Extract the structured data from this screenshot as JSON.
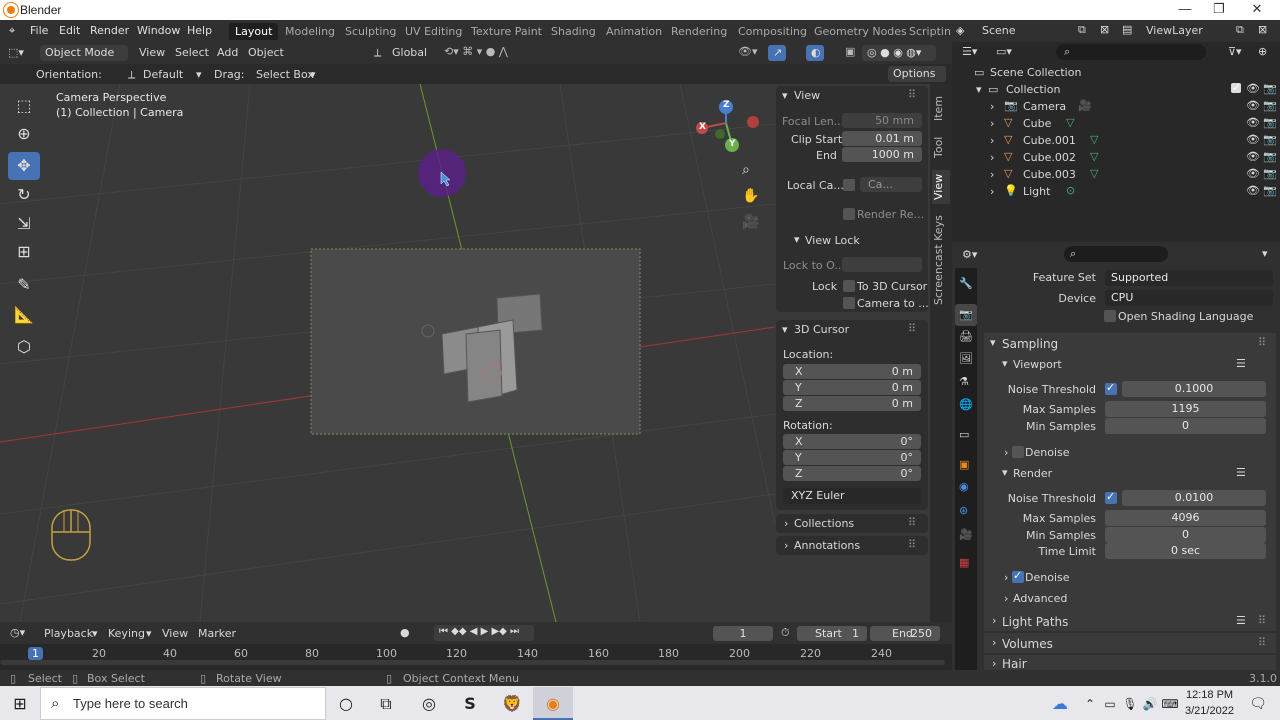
{
  "window": {
    "title": "Blender"
  },
  "menu": [
    "File",
    "Edit",
    "Render",
    "Window",
    "Help"
  ],
  "workspaces": [
    "Layout",
    "Modeling",
    "Sculpting",
    "UV Editing",
    "Texture Paint",
    "Shading",
    "Animation",
    "Rendering",
    "Compositing",
    "Geometry Nodes",
    "Scriptin"
  ],
  "scene": {
    "label": "Scene",
    "view_layer": "ViewLayer"
  },
  "viewport_header": {
    "mode": "Object Mode",
    "menus": [
      "View",
      "Select",
      "Add",
      "Object"
    ],
    "transform": "Global",
    "orientation_label": "Orientation:",
    "orientation_value": "Default",
    "drag_label": "Drag:",
    "drag_value": "Select Box",
    "options": "Options"
  },
  "viewport": {
    "title": "Camera Perspective",
    "subtitle": "(1) Collection | Camera",
    "gizmo": {
      "x": "X",
      "y": "Y",
      "z": "Z"
    }
  },
  "npanel": {
    "view": {
      "header": "View",
      "focal_label": "Focal Len...",
      "focal_value": "50 mm",
      "clip_start_label": "Clip Start",
      "clip_start_value": "0.01 m",
      "end_label": "End",
      "end_value": "1000 m",
      "local_cam_label": "Local Ca...",
      "local_cam_value": "Ca...",
      "render_region": "Render Re...",
      "view_lock_header": "View Lock",
      "lock_to_object": "Lock to O...",
      "lock_label": "Lock",
      "to_3d_cursor": "To 3D Cursor",
      "camera_to": "Camera to ..."
    },
    "cursor": {
      "header": "3D Cursor",
      "location_label": "Location:",
      "loc": [
        {
          "axis": "X",
          "value": "0 m"
        },
        {
          "axis": "Y",
          "value": "0 m"
        },
        {
          "axis": "Z",
          "value": "0 m"
        }
      ],
      "rotation_label": "Rotation:",
      "rot": [
        {
          "axis": "X",
          "value": "0°"
        },
        {
          "axis": "Y",
          "value": "0°"
        },
        {
          "axis": "Z",
          "value": "0°"
        }
      ],
      "rotation_mode": "XYZ Euler"
    },
    "collections": "Collections",
    "annotations": "Annotations",
    "tabs": [
      "Item",
      "Tool",
      "View",
      "Screencast Keys"
    ]
  },
  "outliner": {
    "scene_collection": "Scene Collection",
    "collection": "Collection",
    "items": [
      {
        "name": "Camera",
        "icon_color": "#e8a060"
      },
      {
        "name": "Cube",
        "icon_color": "#e8a060"
      },
      {
        "name": "Cube.001",
        "icon_color": "#e8a060"
      },
      {
        "name": "Cube.002",
        "icon_color": "#e8a060"
      },
      {
        "name": "Cube.003",
        "icon_color": "#e8a060"
      },
      {
        "name": "Light",
        "icon_color": "#e8a060"
      }
    ]
  },
  "properties": {
    "feature_set_label": "Feature Set",
    "feature_set_value": "Supported",
    "device_label": "Device",
    "device_value": "CPU",
    "osl": "Open Shading Language",
    "sampling": "Sampling",
    "viewport": "Viewport",
    "noise_threshold_label": "Noise Threshold",
    "vp_noise": "0.1000",
    "max_samples_label": "Max Samples",
    "vp_max": "1195",
    "min_samples_label": "Min Samples",
    "vp_min": "0",
    "denoise": "Denoise",
    "render": "Render",
    "r_noise": "0.0100",
    "r_max": "4096",
    "r_min": "0",
    "time_limit_label": "Time Limit",
    "r_time": "0 sec",
    "r_denoise": "Denoise",
    "advanced": "Advanced",
    "light_paths": "Light Paths",
    "volumes": "Volumes",
    "hair": "Hair"
  },
  "timeline": {
    "menus": [
      "Playback",
      "Keying",
      "View",
      "Marker"
    ],
    "current_frame": "1",
    "start_label": "Start",
    "start_value": "1",
    "end_label": "End",
    "end_value": "250",
    "ticks": [
      "1",
      "20",
      "40",
      "60",
      "80",
      "100",
      "120",
      "140",
      "160",
      "180",
      "200",
      "220",
      "240"
    ]
  },
  "status": {
    "select": "Select",
    "box_select": "Box Select",
    "rotate_view": "Rotate View",
    "context_menu": "Object Context Menu",
    "version": "3.1.0"
  },
  "taskbar": {
    "search_placeholder": "Type here to search",
    "time": "12:18 PM",
    "date": "3/21/2022"
  }
}
